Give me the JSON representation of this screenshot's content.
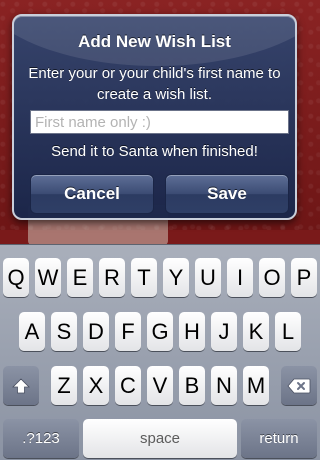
{
  "alert": {
    "title": "Add New Wish List",
    "message": "Enter your or your child's first name to create a wish list.",
    "input_value": "",
    "input_placeholder": "First name only :)",
    "note": "Send it to Santa when finished!",
    "cancel_label": "Cancel",
    "save_label": "Save"
  },
  "keyboard": {
    "row1": [
      "Q",
      "W",
      "E",
      "R",
      "T",
      "Y",
      "U",
      "I",
      "O",
      "P"
    ],
    "row2": [
      "A",
      "S",
      "D",
      "F",
      "G",
      "H",
      "J",
      "K",
      "L"
    ],
    "row3": [
      "Z",
      "X",
      "C",
      "V",
      "B",
      "N",
      "M"
    ],
    "numbers_label": ".?123",
    "space_label": "space",
    "return_label": "return",
    "shift_icon": "shift-arrow-icon",
    "delete_icon": "backspace-icon"
  },
  "colors": {
    "alert_bg": "#26365f",
    "background": "#7a1a1a",
    "keyboard_bg": "#9aa1ae"
  }
}
